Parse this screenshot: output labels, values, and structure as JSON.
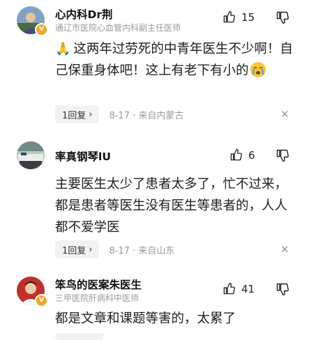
{
  "comments": [
    {
      "name": "心内科Dr荆",
      "subtitle": "通辽市医院心血管内科副主任医师",
      "likes": "15",
      "text_emoji_lead": "🙏",
      "text": "这两年过劳死的中青年医生不少啊！自己保重身体吧！这上有老下有小的",
      "emoji_trail": "crying-face",
      "verified_badge": "V",
      "reply_label": "1回复",
      "meta": "8-17 · 来自内蒙古"
    },
    {
      "name": "率真钢琴lU",
      "subtitle": "",
      "likes": "6",
      "text": "主要医生太少了患者太多了，忙不过来，都是患者等医生没有医生等患者的，人人都不爱学医",
      "reply_label": "1回复",
      "meta": "8-17 · 来自山东"
    },
    {
      "name": "笨鸟的医案朱医生",
      "subtitle": "三甲医院肝病科中医师",
      "likes": "41",
      "text": "都是文章和课题等害的，太累了",
      "verified_badge": "V"
    }
  ],
  "icons": {
    "like": "thumbs-up-icon",
    "dislike": "thumbs-down-icon",
    "reply_chevron": "chevron-right-icon",
    "dismiss": "close-icon"
  },
  "colors": {
    "badge": "#f5a623",
    "meta": "#999999",
    "chip_bg": "#f2f2f2"
  }
}
